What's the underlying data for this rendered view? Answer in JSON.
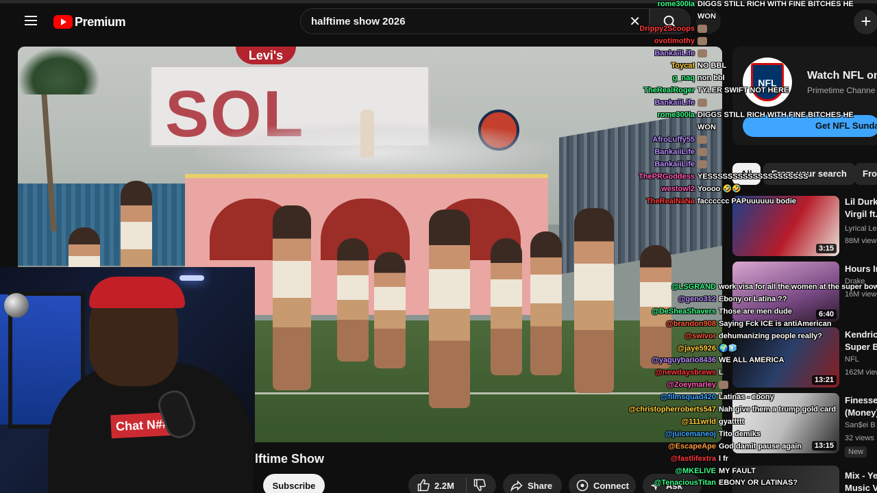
{
  "header": {
    "logo_text": "Premium",
    "search_query": "halftime show 2026",
    "clear_glyph": "✕",
    "create_glyph": "+"
  },
  "video": {
    "billboard_text": "SOL",
    "sign_text": "Levi's",
    "title_partial": "lftime Show",
    "subscribe_label": "Subscribe",
    "like_count": "2.2M",
    "share_label": "Share",
    "connect_label": "Connect",
    "ask_label": "Ask"
  },
  "webcam": {
    "shirt_text": "Chat N##"
  },
  "sidebar": {
    "ad": {
      "logo_text": "NFL",
      "title": "Watch NFL on",
      "subtitle": "Primetime Channe",
      "button": "Get NFL Sunday"
    },
    "chips": [
      "All",
      "From your search",
      "Fro"
    ],
    "recs": [
      {
        "title_lines": [
          "Lil Durk",
          "Virgil ft."
        ],
        "meta": [
          "Lyrical Le",
          "88M view"
        ],
        "duration": "3:15"
      },
      {
        "title_lines": [
          "Hours In"
        ],
        "meta": [
          "Drake",
          "16M view"
        ],
        "duration": "6:40"
      },
      {
        "title_lines": [
          "Kendrick",
          "Super B"
        ],
        "meta": [
          "NFL",
          "162M view"
        ],
        "duration": "13:21"
      },
      {
        "title_lines": [
          "Finesse",
          "(Money)"
        ],
        "meta": [
          "San$ei B",
          "32 views"
        ],
        "duration": "13:15"
      },
      {
        "title_lines": [
          "Mix - Ye",
          "Music V"
        ],
        "meta": [],
        "duration": ""
      }
    ],
    "new_badge": "New"
  },
  "chat": {
    "top": [
      {
        "name": "rome300la",
        "color": "#39ff88",
        "text": "DIGGS STILL RICH WITH FINE BITCHES HE",
        "cont": "WON"
      },
      {
        "name": "Drippy2Scoops",
        "color": "#ff3a3a",
        "text": ""
      },
      {
        "name": "ovotimothy",
        "color": "#ff3a3a",
        "text": ""
      },
      {
        "name": "BankaiiLife",
        "color": "#b78cff",
        "text": ""
      },
      {
        "name": "Toycat",
        "color": "#ffd23a",
        "text": "NO BBL"
      },
      {
        "name": "g_naq",
        "color": "#39ff88",
        "text": "non bbl"
      },
      {
        "name": "TheRealRoger",
        "color": "#39ff88",
        "text": "TYLER SWIFT NOT HERE"
      },
      {
        "name": "BankaiiLife",
        "color": "#b78cff",
        "text": ""
      },
      {
        "name": "rome300la",
        "color": "#39ff88",
        "text": "DIGGS STILL RICH WITH FINE BITCHES HE",
        "cont": "WON"
      },
      {
        "name": "AfroLuffy55",
        "color": "#b78cff",
        "text": ""
      },
      {
        "name": "BankaiiLife",
        "color": "#b78cff",
        "text": ""
      },
      {
        "name": "BankaiiLife",
        "color": "#b78cff",
        "text": ""
      },
      {
        "name": "ThePRGoddess",
        "color": "#ff5ab4",
        "text": "YESSSSSSSSSSSSSSSSSSSS"
      },
      {
        "name": "westowl2",
        "color": "#ff5ab4",
        "text": "Yoooo 🤣🤣"
      },
      {
        "name": "TheRealNaNa",
        "color": "#ff3a3a",
        "text": "facccccc PAPuuuuuu bodie"
      }
    ],
    "bottom": [
      {
        "name": "@LSGRAND",
        "color": "#39ff88",
        "text": "work visa for all the women at the super bowl"
      },
      {
        "name": "@geno312",
        "color": "#b78cff",
        "text": "Ebony or Latina ??"
      },
      {
        "name": "@DeSheaShavers",
        "color": "#39ff88",
        "text": "Those are men dude"
      },
      {
        "name": "@brandon908",
        "color": "#ff5a3a",
        "text": "Saying Fck ICE is antiAmerican"
      },
      {
        "name": "@swivor",
        "color": "#ff5a3a",
        "text": "dehumanizing people really?"
      },
      {
        "name": "@jaye5926",
        "color": "#ffd23a",
        "text": "🌍🧊"
      },
      {
        "name": "@yaguybario8436",
        "color": "#b78cff",
        "text": "WE ALL AMERICA"
      },
      {
        "name": "@newdaysbrews",
        "color": "#ff3a3a",
        "text": "L"
      },
      {
        "name": "@Zoeymarley",
        "color": "#ff5ab4",
        "text": ""
      },
      {
        "name": "@filmsquad420",
        "color": "#3ea6ff",
        "text": "Latinas - ebony"
      },
      {
        "name": "@christopherroberts547",
        "color": "#ffd23a",
        "text": "Nah give them a trump gold card"
      },
      {
        "name": "@111wrld",
        "color": "#ffd23a",
        "text": "gyattttt"
      },
      {
        "name": "@juicemaneoj",
        "color": "#3ea6ff",
        "text": "Tito demiks"
      },
      {
        "name": "@EscapeApe",
        "color": "#ff9a3a",
        "text": "God damit pause again"
      },
      {
        "name": "@fastlifextra",
        "color": "#ff3a3a",
        "text": "l fr"
      },
      {
        "name": "@MKELIVE",
        "color": "#39ff88",
        "text": "MY FAULT"
      },
      {
        "name": "@TenaciousTitan",
        "color": "#39ff88",
        "text": "EBONY OR LATINAS?"
      }
    ]
  }
}
